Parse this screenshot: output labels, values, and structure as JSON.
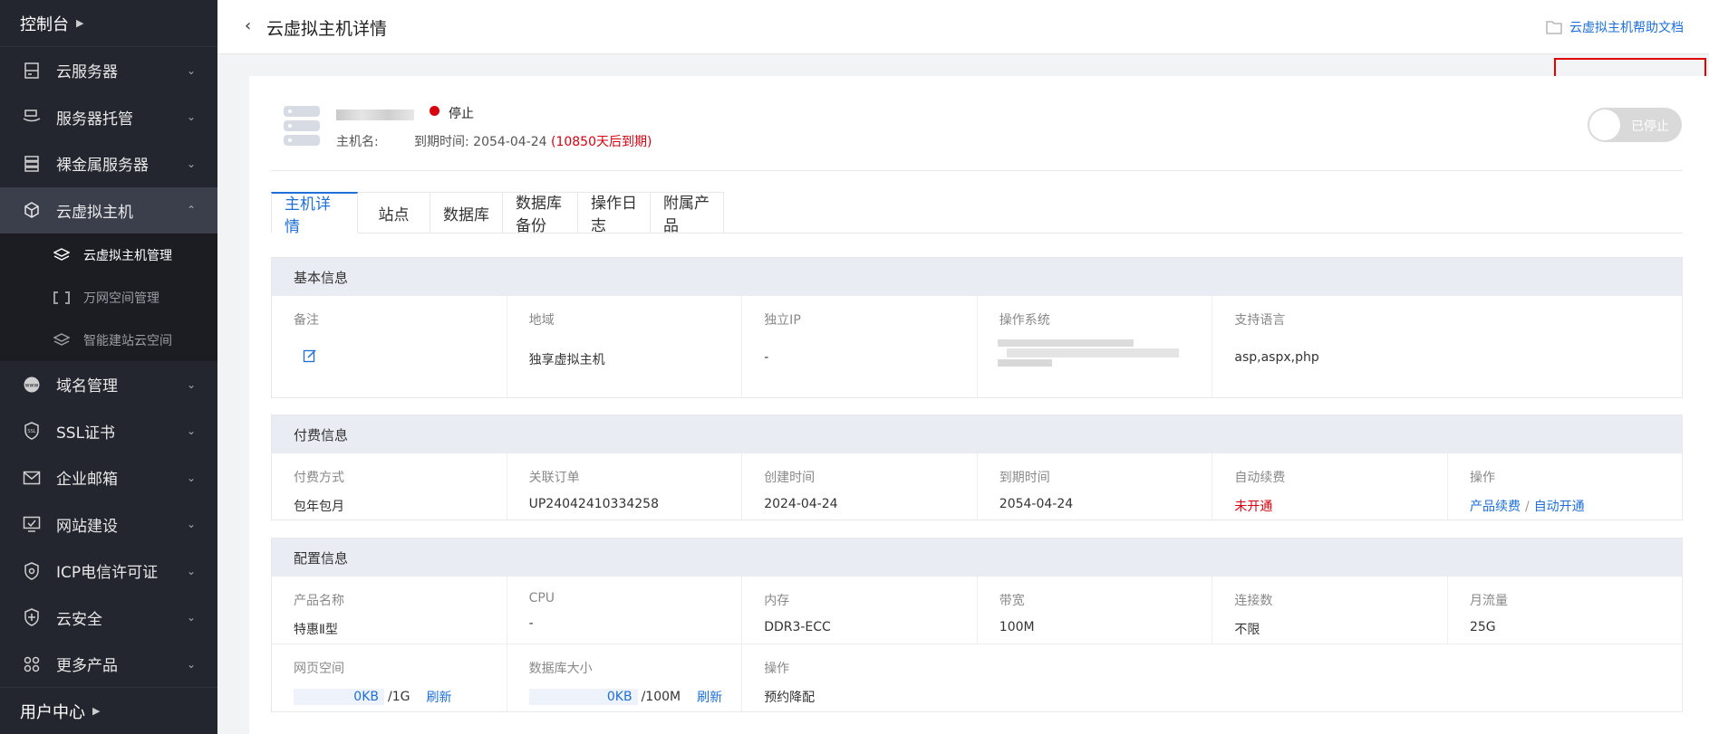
{
  "sidebar": {
    "console": "控制台",
    "items": [
      {
        "label": "云服务器",
        "icon": "server-icon"
      },
      {
        "label": "服务器托管",
        "icon": "hosting-icon"
      },
      {
        "label": "裸金属服务器",
        "icon": "baremetal-icon"
      },
      {
        "label": "云虚拟主机",
        "icon": "cube-icon"
      },
      {
        "label": "域名管理",
        "icon": "www-icon"
      },
      {
        "label": "SSL证书",
        "icon": "ssl-shield-icon"
      },
      {
        "label": "企业邮箱",
        "icon": "mail-icon"
      },
      {
        "label": "网站建设",
        "icon": "monitor-check-icon"
      },
      {
        "label": "ICP电信许可证",
        "icon": "icp-shield-icon"
      },
      {
        "label": "云安全",
        "icon": "security-shield-icon"
      },
      {
        "label": "更多产品",
        "icon": "grid-icon"
      }
    ],
    "subitems": [
      {
        "label": "云虚拟主机管理"
      },
      {
        "label": "万网空间管理"
      },
      {
        "label": "智能建站云空间"
      }
    ],
    "user_center": "用户中心"
  },
  "header": {
    "title": "云虚拟主机详情",
    "help": "云虚拟主机帮助文档"
  },
  "host": {
    "status": "停止",
    "hostname_label": "主机名:",
    "expire_label": "到期时间:",
    "expire_date": "2054-04-24",
    "expire_note": "(10850天后到期)",
    "toggle_label": "已停止"
  },
  "tabs": [
    "主机详情",
    "站点",
    "数据库",
    "数据库备份",
    "操作日志",
    "附属产品"
  ],
  "basic": {
    "title": "基本信息",
    "remark_label": "备注",
    "region_label": "地域",
    "region_value": "独享虚拟主机",
    "ip_label": "独立IP",
    "ip_value": "-",
    "os_label": "操作系统",
    "lang_label": "支持语言",
    "lang_value": "asp,aspx,php"
  },
  "billing": {
    "title": "付费信息",
    "cols": [
      {
        "label": "付费方式",
        "value": "包年包月"
      },
      {
        "label": "关联订单",
        "value": "UP24042410334258"
      },
      {
        "label": "创建时间",
        "value": "2024-04-24"
      },
      {
        "label": "到期时间",
        "value": "2054-04-24"
      },
      {
        "label": "自动续费",
        "value": "未开通"
      }
    ],
    "ops_label": "操作",
    "renew": "产品续费",
    "sep": "/",
    "auto": "自动开通"
  },
  "config": {
    "title": "配置信息",
    "cols": [
      {
        "label": "产品名称",
        "value": "特惠Ⅱ型"
      },
      {
        "label": "CPU",
        "value": "-"
      },
      {
        "label": "内存",
        "value": "DDR3-ECC"
      },
      {
        "label": "带宽",
        "value": "100M"
      },
      {
        "label": "连接数",
        "value": "不限"
      },
      {
        "label": "月流量",
        "value": "25G"
      }
    ],
    "web_space_label": "网页空间",
    "web_used": "0KB",
    "web_total": "/1G",
    "web_fraction": 0,
    "db_size_label": "数据库大小",
    "db_used": "0KB",
    "db_total": "/100M",
    "db_fraction": 0,
    "refresh": "刷新",
    "ops_label": "操作",
    "ops_value": "预约降配"
  },
  "colors": {
    "accent": "#1e6fd9",
    "danger": "#d6000f",
    "sidebar": "#23262e"
  }
}
